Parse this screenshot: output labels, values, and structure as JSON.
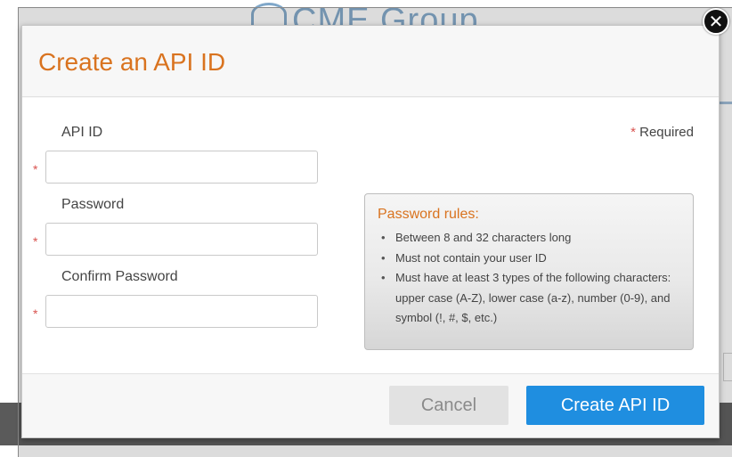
{
  "background": {
    "logo_text": "CME Group"
  },
  "modal": {
    "title": "Create an API ID",
    "close_icon": "close-icon",
    "required_note": {
      "star": "*",
      "label": "Required"
    },
    "fields": [
      {
        "label": "API ID",
        "value": "",
        "placeholder": "",
        "required_star": "*"
      },
      {
        "label": "Password",
        "value": "",
        "placeholder": "",
        "required_star": "*"
      },
      {
        "label": "Confirm Password",
        "value": "",
        "placeholder": "",
        "required_star": "*"
      }
    ],
    "password_rules": {
      "title": "Password rules:",
      "items": [
        "Between 8 and 32 characters long",
        "Must not contain your user ID",
        "Must have at least 3 types of the following characters: upper case (A-Z), lower case (a-z), number (0-9), and symbol (!, #, $, etc.)"
      ]
    },
    "buttons": {
      "cancel": "Cancel",
      "create": "Create API ID"
    }
  },
  "colors": {
    "title_orange": "#d9731f",
    "primary_blue": "#1f8ee0",
    "required_red": "#d9534f"
  }
}
